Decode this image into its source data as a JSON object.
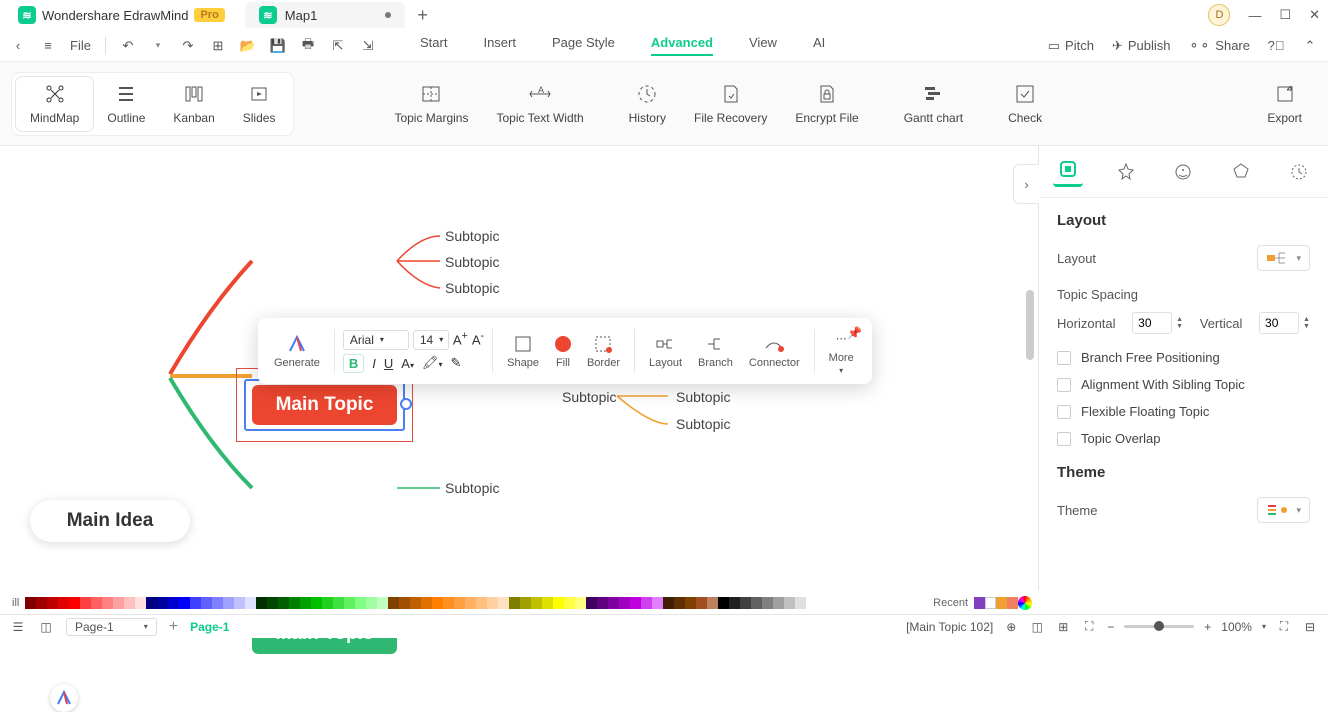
{
  "app": {
    "name": "Wondershare EdrawMind",
    "badge": "Pro"
  },
  "doc": {
    "tab": "Map1"
  },
  "toolbar": {
    "file": "File"
  },
  "menu": {
    "start": "Start",
    "insert": "Insert",
    "pagestyle": "Page Style",
    "advanced": "Advanced",
    "view": "View",
    "ai": "AI"
  },
  "actions": {
    "pitch": "Pitch",
    "publish": "Publish",
    "share": "Share"
  },
  "views": {
    "mindmap": "MindMap",
    "outline": "Outline",
    "kanban": "Kanban",
    "slides": "Slides"
  },
  "ribbon": {
    "topic_margins": "Topic Margins",
    "topic_text_width": "Topic Text Width",
    "history": "History",
    "file_recovery": "File Recovery",
    "encrypt_file": "Encrypt File",
    "gantt": "Gantt chart",
    "check": "Check",
    "export": "Export"
  },
  "nodes": {
    "main_idea": "Main Idea",
    "main_topic": "Main Topic",
    "subtopic": "Subtopic"
  },
  "floatbar": {
    "generate": "Generate",
    "font": "Arial",
    "size": "14",
    "shape": "Shape",
    "fill": "Fill",
    "border": "Border",
    "layout": "Layout",
    "branch": "Branch",
    "connector": "Connector",
    "more": "More"
  },
  "panel": {
    "layout_h": "Layout",
    "layout_l": "Layout",
    "spacing": "Topic Spacing",
    "horizontal": "Horizontal",
    "h_val": "30",
    "vertical": "Vertical",
    "v_val": "30",
    "branch_free": "Branch Free Positioning",
    "align_sibling": "Alignment With Sibling Topic",
    "flex_float": "Flexible Floating Topic",
    "overlap": "Topic Overlap",
    "theme_h": "Theme",
    "theme_l": "Theme"
  },
  "colorbar": {
    "fill": "ill",
    "recent": "Recent"
  },
  "status": {
    "page_sel": "Page-1",
    "page_tab": "Page-1",
    "selection": "[Main Topic 102]",
    "zoom": "100%"
  },
  "avatar": "D"
}
